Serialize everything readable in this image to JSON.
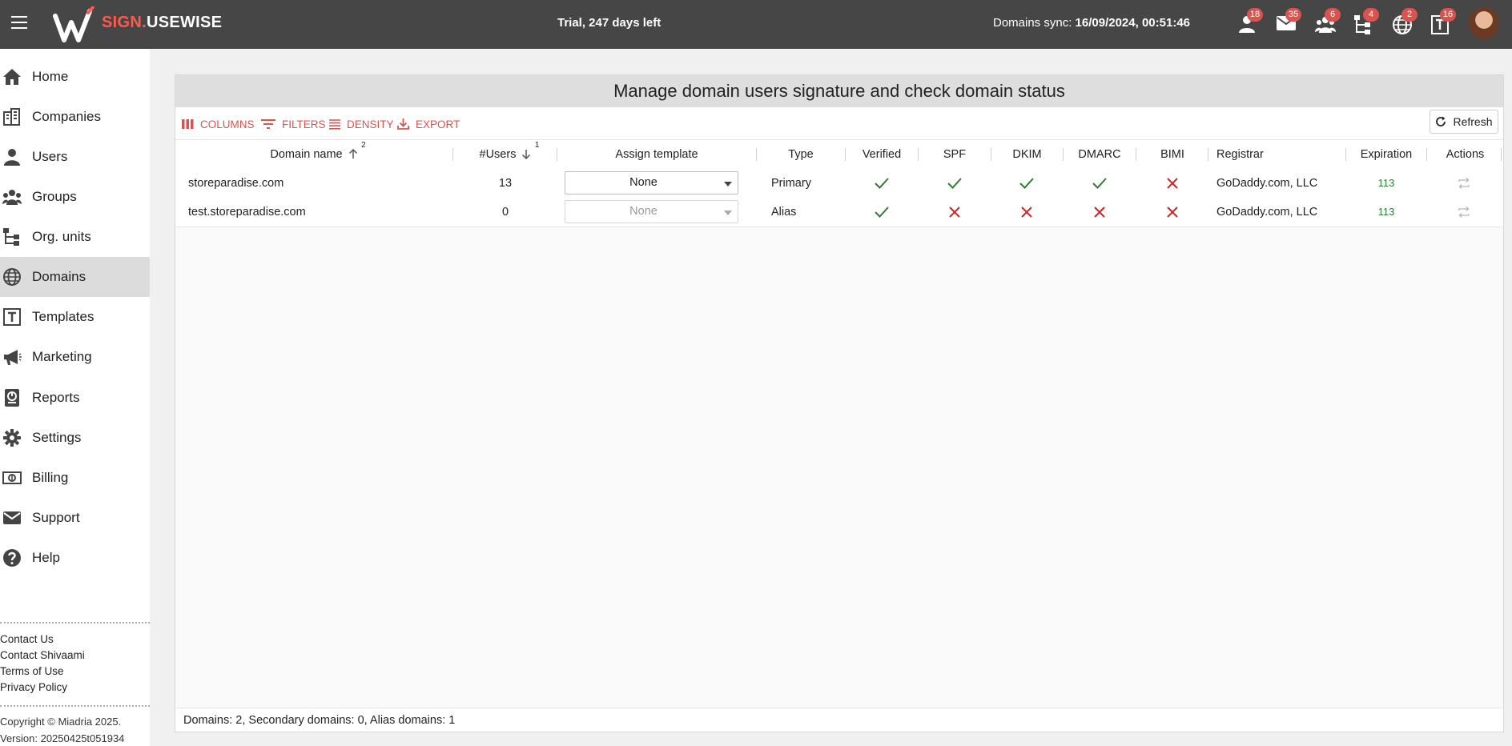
{
  "topbar": {
    "brand_red": "SIGN.",
    "brand_white": "USEWISE",
    "trial": "Trial, 247 days left",
    "sync_label": "Domains sync: ",
    "sync_value": "16/09/2024, 00:51:46",
    "badges": {
      "users": "18",
      "mail": "35",
      "groups": "6",
      "org": "4",
      "domains": "2",
      "templates": "16"
    }
  },
  "sidebar": {
    "items": [
      {
        "label": "Home",
        "icon": "home-icon"
      },
      {
        "label": "Companies",
        "icon": "companies-icon"
      },
      {
        "label": "Users",
        "icon": "user-icon"
      },
      {
        "label": "Groups",
        "icon": "groups-icon"
      },
      {
        "label": "Org. units",
        "icon": "org-units-icon"
      },
      {
        "label": "Domains",
        "icon": "globe-icon"
      },
      {
        "label": "Templates",
        "icon": "template-icon"
      },
      {
        "label": "Marketing",
        "icon": "megaphone-icon"
      },
      {
        "label": "Reports",
        "icon": "reports-icon"
      },
      {
        "label": "Settings",
        "icon": "gear-icon"
      },
      {
        "label": "Billing",
        "icon": "billing-icon"
      },
      {
        "label": "Support",
        "icon": "mail-icon"
      },
      {
        "label": "Help",
        "icon": "help-icon"
      }
    ],
    "links": [
      "Contact Us",
      "Contact Shivaami",
      "Terms of Use",
      "Privacy Policy"
    ],
    "copyright": "Copyright © Miadria 2025.",
    "version": "Version: 20250425t051934"
  },
  "main": {
    "title": "Manage domain users signature and check domain status",
    "toolbar": {
      "columns": "COLUMNS",
      "filters": "FILTERS",
      "density": "DENSITY",
      "export": "EXPORT",
      "refresh": "Refresh"
    },
    "headers": {
      "domain": "Domain name",
      "domain_sort": "2",
      "users": "#Users",
      "users_sort": "1",
      "assign": "Assign template",
      "type": "Type",
      "verified": "Verified",
      "spf": "SPF",
      "dkim": "DKIM",
      "dmarc": "DMARC",
      "bimi": "BIMI",
      "registrar": "Registrar",
      "expiration": "Expiration",
      "actions": "Actions"
    },
    "rows": [
      {
        "domain": "storeparadise.com",
        "users": "13",
        "template": "None",
        "type": "Primary",
        "verified": true,
        "spf": true,
        "dkim": true,
        "dmarc": true,
        "bimi": false,
        "registrar": "GoDaddy.com, LLC",
        "expiration": "113"
      },
      {
        "domain": "test.storeparadise.com",
        "users": "0",
        "template": "None",
        "type": "Alias",
        "verified": true,
        "spf": false,
        "dkim": false,
        "dmarc": false,
        "bimi": false,
        "registrar": "GoDaddy.com, LLC",
        "expiration": "113"
      }
    ],
    "footer": "Domains: 2, Secondary domains: 0, Alias domains: 1"
  },
  "colors": {
    "accent": "#d9534f",
    "ok": "#2e7d32",
    "fail": "#c62828",
    "topbar": "#464646"
  }
}
